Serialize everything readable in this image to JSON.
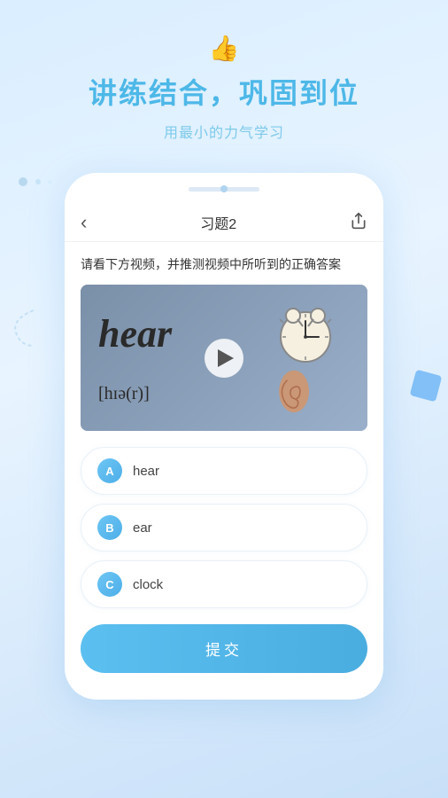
{
  "app": {
    "background_color": "#daeeff"
  },
  "header": {
    "main_title": "讲练结合，巩固到位",
    "sub_title": "用最小的力气学习"
  },
  "phone": {
    "nav": {
      "back_icon": "‹",
      "title": "习题2",
      "share_icon": "⎙"
    },
    "question": {
      "text": "请看下方视频，并推测视频中所听到的正确答案"
    },
    "video": {
      "word": "hear",
      "phonetic": "[hɪə(r)]",
      "play_icon": "play"
    },
    "options": [
      {
        "id": "A",
        "label": "hear"
      },
      {
        "id": "B",
        "label": "ear"
      },
      {
        "id": "C",
        "label": "clock"
      }
    ],
    "submit": {
      "label": "提交"
    }
  },
  "colors": {
    "accent": "#4db8e8",
    "option_badge": "#6ec6f5",
    "submit_btn": "#5bbff0"
  }
}
